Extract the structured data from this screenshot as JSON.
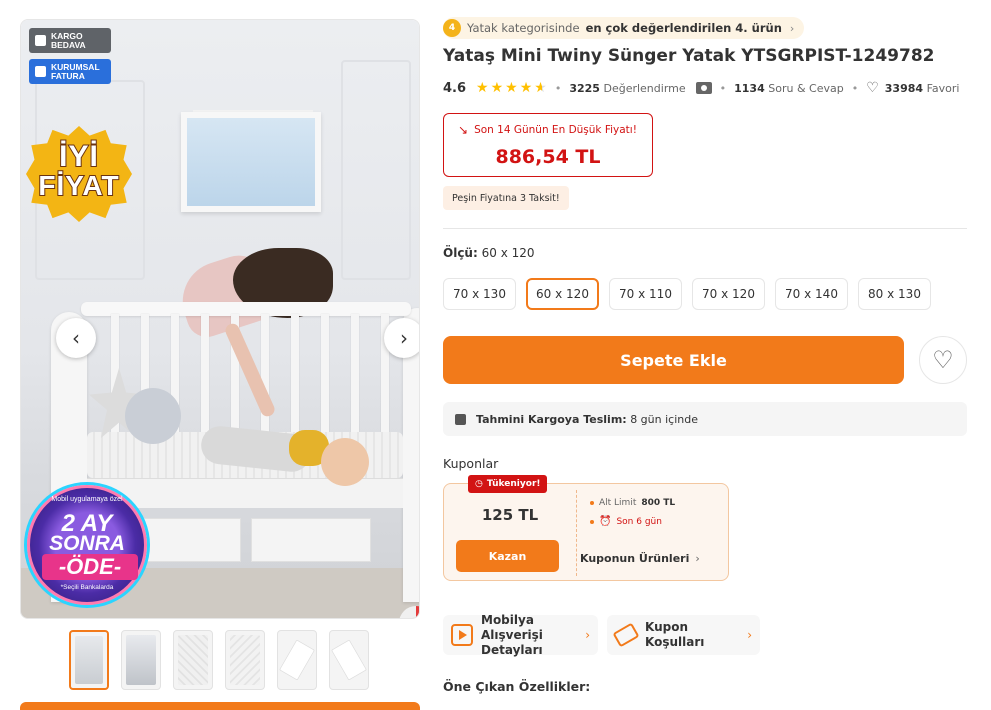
{
  "gallery": {
    "badges": {
      "kargo": "KARGO BEDAVA",
      "fatura": "KURUMSAL FATURA"
    },
    "promo_iyi": "İYİ",
    "promo_fiyat": "FİYAT",
    "campaign": {
      "top": "Mobil uygulamaya özel",
      "line1": "2 AY",
      "line2": "SONRA",
      "line3": "-ÖDE-",
      "footer": "*Seçili Bankalarda"
    },
    "prev_icon": "chevron-left-icon",
    "next_icon": "chevron-right-icon",
    "thumbnail_count": 6,
    "active_thumbnail": 1
  },
  "rank": {
    "medal": "4",
    "prefix": "Yatak kategorisinde",
    "highlight": "en çok değerlendirilen 4. ürün"
  },
  "product": {
    "brand": "Yataş Mini",
    "name": "Twiny Sünger Yatak YTSGRPIST-1249782"
  },
  "rating": {
    "score": "4.6",
    "stars": 4.6,
    "review_count": "3225",
    "review_label": "Değerlendirme",
    "qa_count": "1134",
    "qa_label": "Soru & Cevap",
    "fav_count": "33984",
    "fav_label": "Favori"
  },
  "price": {
    "label": "Son 14 Günün En Düşük Fiyatı!",
    "value": "886,54 TL",
    "installment": "Peşin Fiyatına 3 Taksit!"
  },
  "size": {
    "label": "Ölçü:",
    "selected_value": "60 x 120",
    "options": [
      "70 x 130",
      "60 x 120",
      "70 x 110",
      "70 x 120",
      "70 x 140",
      "80 x 130"
    ],
    "selected_index": 1
  },
  "actions": {
    "add_to_cart": "Sepete Ekle"
  },
  "shipping": {
    "label": "Tahmini Kargoya Teslim:",
    "value": "8 gün içinde"
  },
  "coupons": {
    "title": "Kuponlar",
    "badge": "Tükeniyor!",
    "amount": "125 TL",
    "button": "Kazan",
    "limit_label": "Alt Limit",
    "limit_value": "800 TL",
    "days_left": "Son 6 gün",
    "products_link": "Kuponun Ürünleri"
  },
  "info_cards": {
    "furniture_line1": "Mobilya Alışverişi",
    "furniture_line2": "Detayları",
    "coupon_terms": "Kupon Koşulları"
  },
  "features": {
    "title": "Öne Çıkan Özellikler:"
  },
  "colors": {
    "accent": "#f27a1a",
    "discount_red": "#d21313",
    "star": "#ffc000"
  }
}
